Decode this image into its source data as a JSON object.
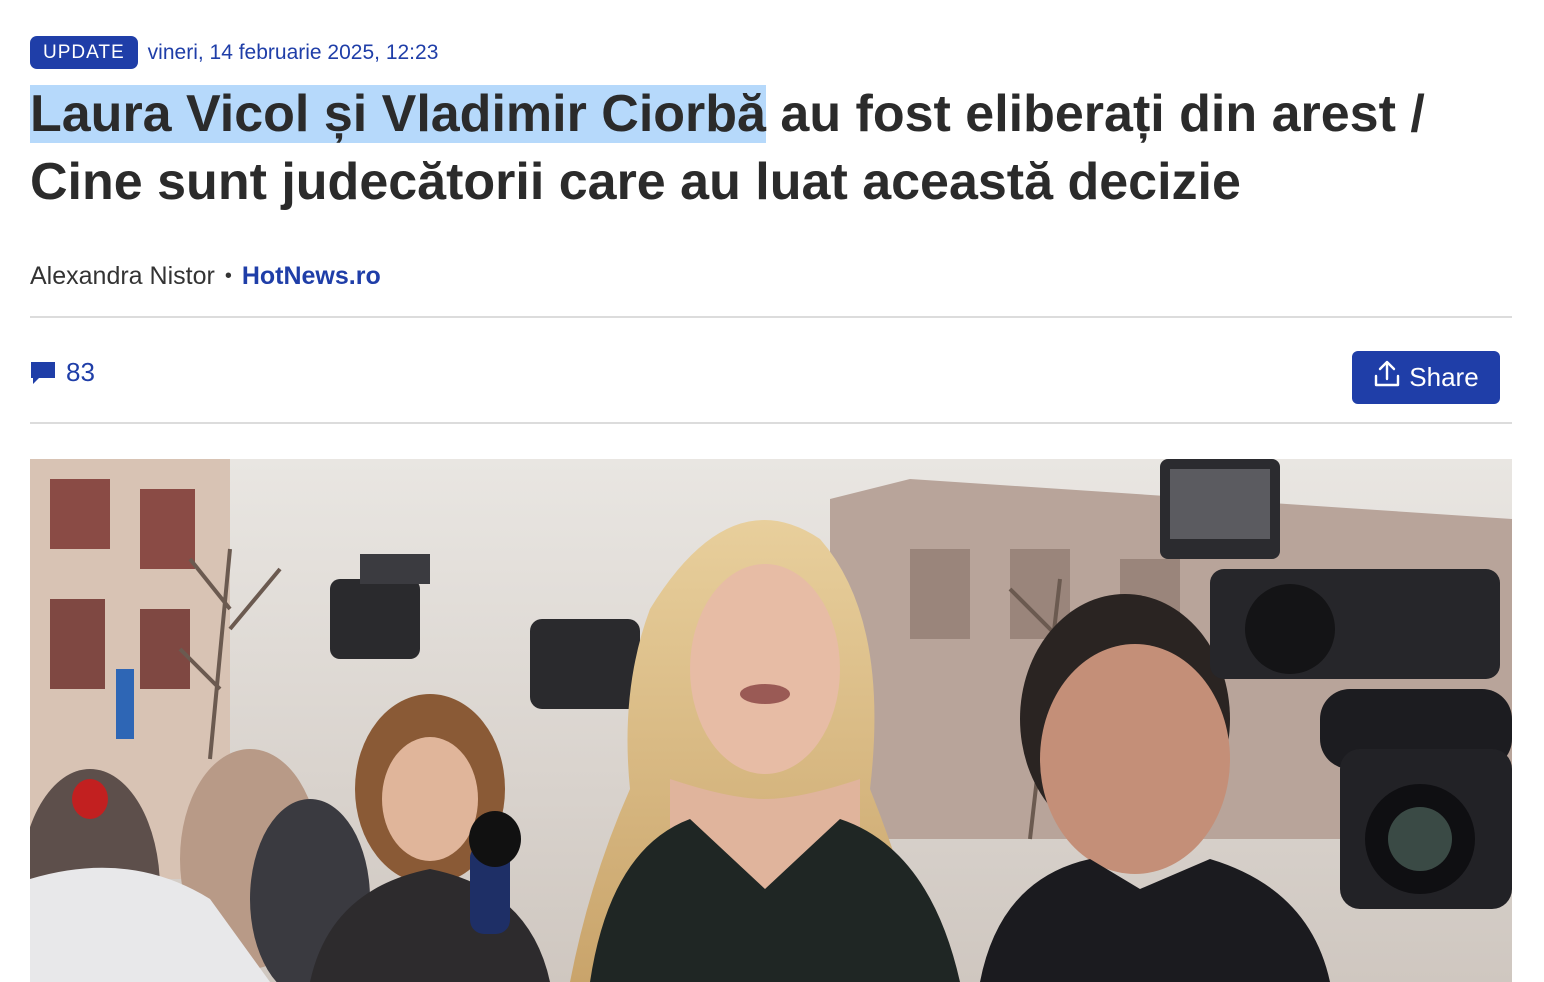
{
  "header": {
    "badge": "UPDATE",
    "date": "vineri, 14 februarie 2025, 12:23"
  },
  "headline": {
    "highlighted": "Laura Vicol și Vladimir Ciorbă",
    "rest": " au fost eliberați din arest / Cine sunt judecătorii care au luat această decizie"
  },
  "byline": {
    "author": "Alexandra Nistor",
    "separator": "•",
    "source": "HotNews.ro"
  },
  "toolbar": {
    "comments_icon": "comment-icon",
    "comments_count": "83",
    "share_icon": "share-upload-icon",
    "share_label": "Share"
  },
  "colors": {
    "accent": "#1f3ea8",
    "highlight": "#b6d9fb",
    "text": "#2b2b2b",
    "divider": "#dcdcdc"
  }
}
